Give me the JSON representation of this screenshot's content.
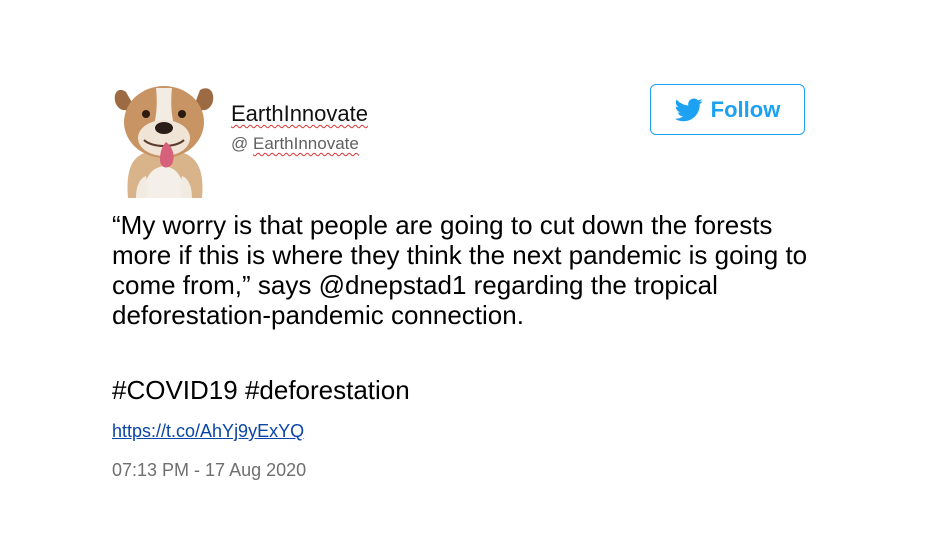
{
  "user": {
    "name": "EarthInnovate",
    "handle_prefix": "@ ",
    "handle": "EarthInnovate",
    "avatar_icon": "bulldog-avatar"
  },
  "follow_button": {
    "label": "Follow",
    "icon": "twitter-bird-icon",
    "color": "#1da1f2"
  },
  "tweet": {
    "text": "“My worry is that people are going to cut down the forests more if this is where they think the next pandemic is going to come from,” says @dnepstad1 regarding the tropical deforestation-pandemic connection.",
    "hashtags": "#COVID19 #deforestation",
    "link": "https://t.co/AhYj9yExYQ",
    "timestamp": "07:13 PM - 17 Aug 2020"
  }
}
